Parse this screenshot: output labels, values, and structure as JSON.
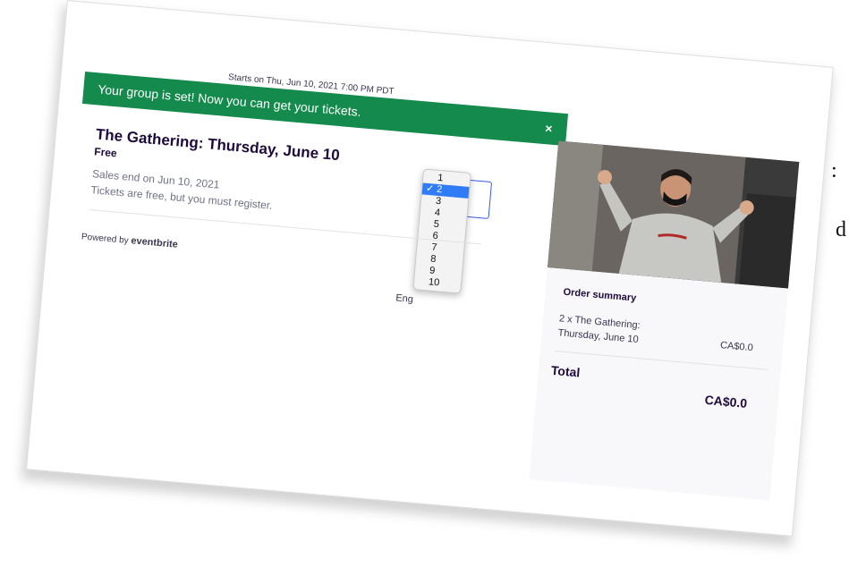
{
  "background_fragments": [
    ":",
    "d"
  ],
  "header": {
    "starts": "Starts on Thu, Jun 10, 2021 7:00 PM PDT"
  },
  "banner": {
    "message": "Your group is set! Now you can get your tickets.",
    "close_icon": "×",
    "color": "#148a4c"
  },
  "ticket": {
    "title": "The Gathering: Thursday, June 10",
    "price": "Free",
    "sales_end": "Sales end on Jun 10, 2021",
    "note": "Tickets are free, but you must register.",
    "quantity_options": [
      "1",
      "2",
      "3",
      "4",
      "5",
      "6",
      "7",
      "8",
      "9",
      "10"
    ],
    "selected_quantity": "2",
    "check_mark": "✓"
  },
  "footer": {
    "powered_by": "Powered by",
    "brand": "eventbrite",
    "language": "Eng"
  },
  "order_summary": {
    "title": "Order summary",
    "item": "2 x The Gathering: Thursday, June 10",
    "item_price": "CA$0.0",
    "total_label": "Total",
    "total_value": "CA$0.0"
  },
  "colors": {
    "accent": "#3659e3",
    "selection": "#2f7cf6",
    "text_dark": "#1e0a3c",
    "text_muted": "#6f7287"
  }
}
